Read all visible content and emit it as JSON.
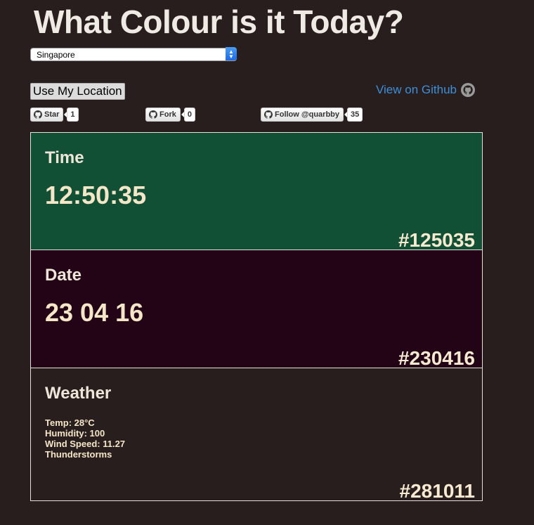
{
  "title": "What Colour is it Today?",
  "location_select": {
    "value": "Singapore"
  },
  "use_location_label": "Use My Location",
  "github_link": {
    "label": "View on Github"
  },
  "github_buttons": {
    "star": {
      "label": "Star",
      "count": "1"
    },
    "fork": {
      "label": "Fork",
      "count": "0"
    },
    "follow": {
      "label": "Follow @quarbby",
      "count": "35"
    }
  },
  "panels": {
    "time": {
      "label": "Time",
      "value": "12:50:35",
      "hex": "#125035",
      "color": "#125035"
    },
    "date": {
      "label": "Date",
      "value": "23 04 16",
      "hex": "#230416",
      "color": "#230416"
    },
    "weather": {
      "label": "Weather",
      "temp": "Temp: 28°C",
      "humidity": "Humidity: 100",
      "wind": "Wind Speed: 11.27",
      "condition": "Thunderstorms",
      "hex": "#281011",
      "color": "#281e1e"
    }
  },
  "colors": {
    "background": "#281e1e",
    "link": "#3d8fd8"
  },
  "icons": {
    "github": "github-octocat-icon",
    "select": "select-arrows-icon"
  }
}
